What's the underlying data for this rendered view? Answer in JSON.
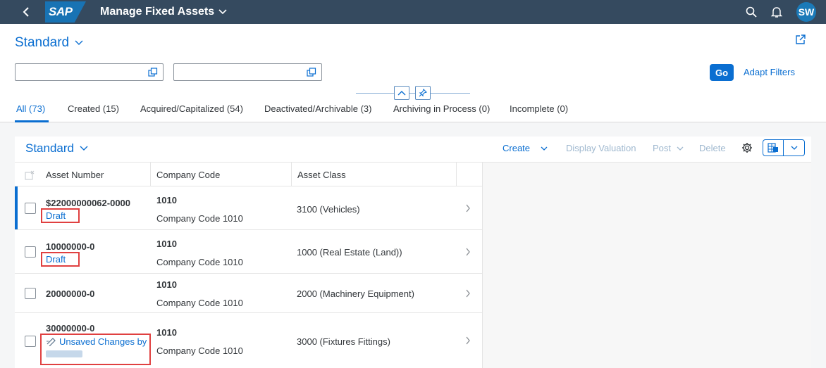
{
  "shell": {
    "logo_text": "SAP",
    "app_title": "Manage Fixed Assets",
    "avatar_initials": "SW"
  },
  "header": {
    "variant_name": "Standard",
    "go_label": "Go",
    "adapt_filters_label": "Adapt Filters"
  },
  "tabs": [
    {
      "label": "All (73)"
    },
    {
      "label": "Created (15)"
    },
    {
      "label": "Acquired/Capitalized (54)"
    },
    {
      "label": "Deactivated/Archivable (3)"
    },
    {
      "label": "Archiving in Process (0)"
    },
    {
      "label": "Incomplete (0)"
    }
  ],
  "table": {
    "title": "Standard",
    "toolbar": {
      "create": "Create",
      "display_valuation": "Display Valuation",
      "post": "Post",
      "delete": "Delete"
    },
    "columns": [
      "Asset Number",
      "Company Code",
      "Asset Class"
    ],
    "rows": [
      {
        "asset": "$22000000062-0000",
        "status": "Draft",
        "cc_code": "1010",
        "cc_name": "Company Code 1010",
        "asset_class": "3100 (Vehicles)"
      },
      {
        "asset": "10000000-0",
        "status": "Draft",
        "cc_code": "1010",
        "cc_name": "Company Code 1010",
        "asset_class": "1000 (Real Estate (Land))"
      },
      {
        "asset": "20000000-0",
        "status": "",
        "cc_code": "1010",
        "cc_name": "Company Code 1010",
        "asset_class": "2000 (Machinery Equipment)"
      },
      {
        "asset": "30000000-0",
        "status": "Unsaved Changes by",
        "cc_code": "1010",
        "cc_name": "Company Code 1010",
        "asset_class": "3000 (Fixtures Fittings)"
      }
    ]
  },
  "colors": {
    "shell_bg": "#354a5f",
    "accent": "#0a6ed1",
    "highlight_box": "#e04040"
  }
}
